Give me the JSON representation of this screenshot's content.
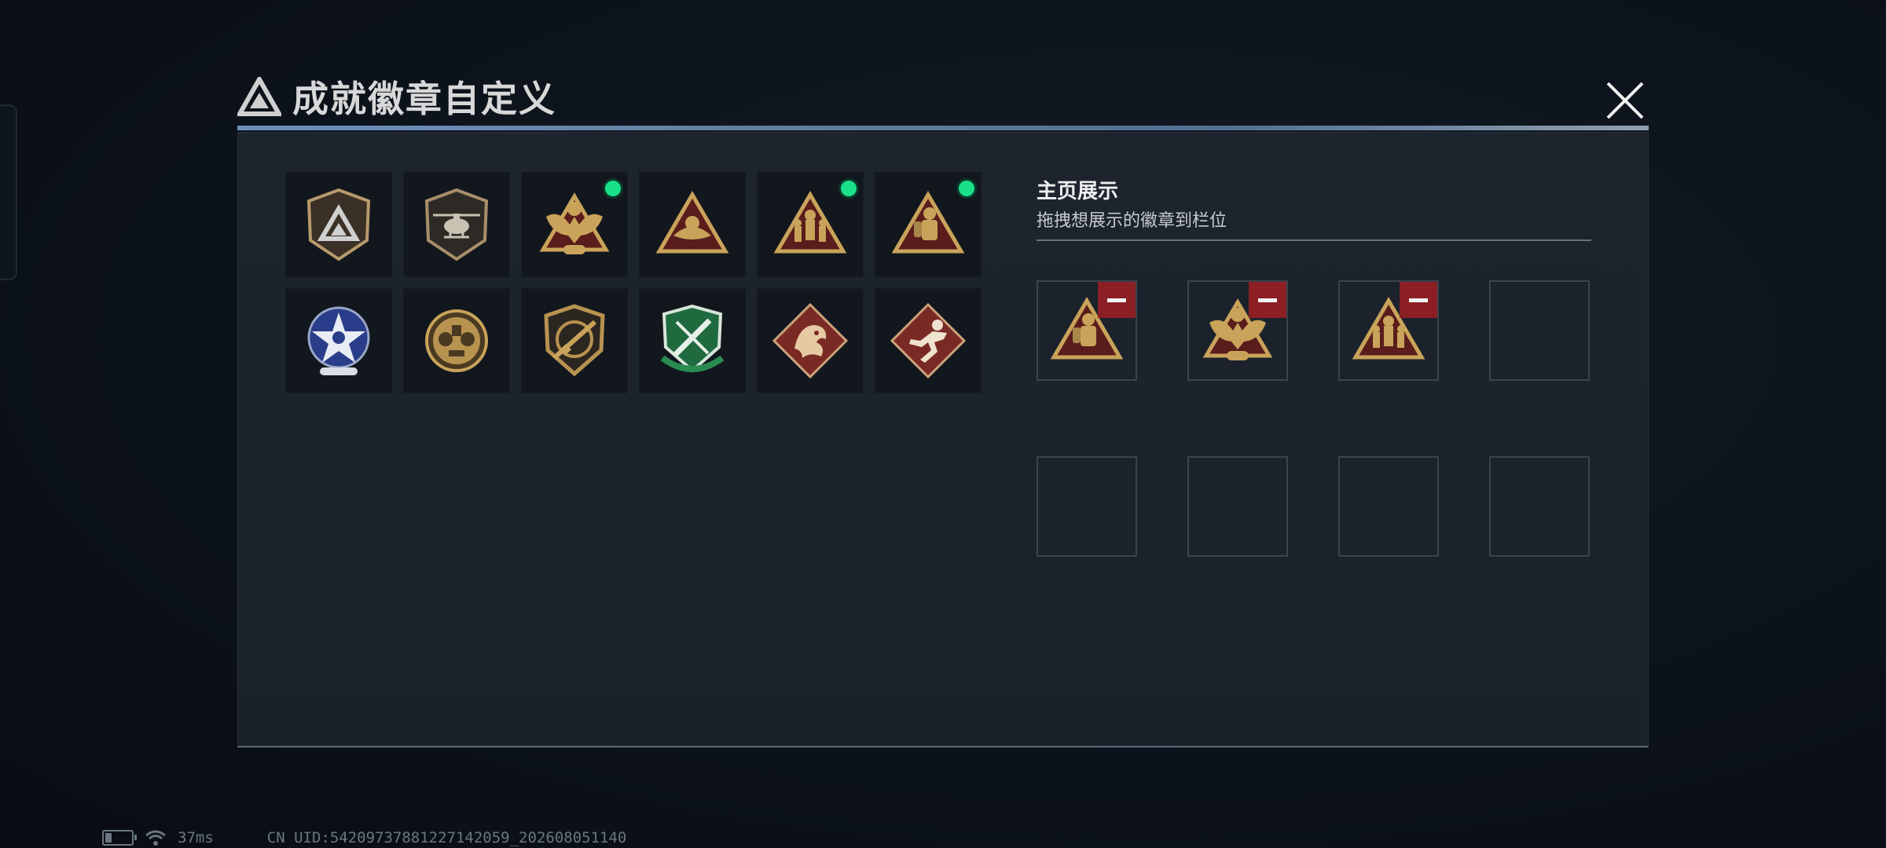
{
  "modal": {
    "title": "成就徽章自定义",
    "icons": {
      "logo": "triangle-logo-icon",
      "close": "close-icon"
    }
  },
  "badges": [
    {
      "name": "gray-shield-triangle",
      "equipped": false
    },
    {
      "name": "helicopter-shield",
      "equipped": false
    },
    {
      "name": "gold-eagle-triangle",
      "equipped": true
    },
    {
      "name": "gold-triangle-emblem",
      "equipped": false
    },
    {
      "name": "gold-soldiers-triangle",
      "equipped": true
    },
    {
      "name": "gold-firefighter-triangle",
      "equipped": true
    },
    {
      "name": "blue-star-medal",
      "equipped": false
    },
    {
      "name": "gold-skull-medal",
      "equipped": false
    },
    {
      "name": "rifle-shield",
      "equipped": false
    },
    {
      "name": "green-knife-shield",
      "equipped": false
    },
    {
      "name": "red-dragon-diamond",
      "equipped": false
    },
    {
      "name": "red-runner-diamond",
      "equipped": false
    }
  ],
  "showcase": {
    "title": "主页展示",
    "subtitle": "拖拽想展示的徽章到栏位",
    "slots": [
      {
        "badge": "gold-firefighter-triangle",
        "removable": true
      },
      {
        "badge": "gold-eagle-triangle",
        "removable": true
      },
      {
        "badge": "gold-soldiers-triangle",
        "removable": true
      },
      {
        "badge": null,
        "removable": false
      },
      {
        "badge": null,
        "removable": false
      },
      {
        "badge": null,
        "removable": false
      },
      {
        "badge": null,
        "removable": false
      },
      {
        "badge": null,
        "removable": false
      }
    ]
  },
  "status": {
    "ping": "37ms",
    "uid": "CN UID:54209737881227142059_202608051140",
    "icons": {
      "battery": "battery-icon",
      "wifi": "wifi-icon"
    }
  },
  "colors": {
    "equipped_dot": "#19e08a",
    "remove_button": "#8b1f24",
    "gold": "#c9a35a"
  }
}
